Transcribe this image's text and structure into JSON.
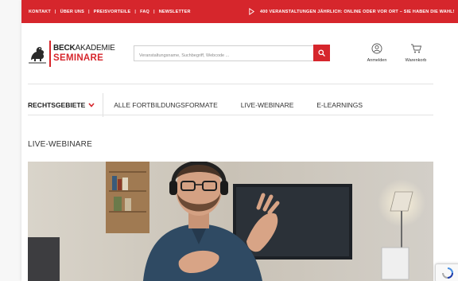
{
  "topbar": {
    "nav": [
      "KONTAKT",
      "ÜBER UNS",
      "PREISVORTEILE",
      "FAQ",
      "NEWSLETTER"
    ],
    "promo": "400 VERANSTALTUNGEN JÄHRLICH: ONLINE ODER VOR ORT – SIE HABEN DIE WAHL!"
  },
  "logo": {
    "line1_bold": "BECK",
    "line1_light": "AKADEMIE",
    "line2": "SEMINARE"
  },
  "search": {
    "placeholder": "Veranstaltungsname, Suchbegriff, Webcode ..."
  },
  "header": {
    "login_label": "Anmelden",
    "cart_label": "Warenkorb"
  },
  "mainnav": {
    "rechtsgebiete": "RECHTSGEBIETE",
    "items": [
      "ALLE FORTBILDUNGSFORMATE",
      "LIVE-WEBINARE",
      "E-LEARNINGS"
    ]
  },
  "page": {
    "title": "LIVE-WEBINARE"
  },
  "colors": {
    "brand_red": "#d6262c",
    "text_dark": "#222222",
    "divider": "#e3e3e3"
  },
  "icons": {
    "search": "search-icon",
    "user": "user-icon",
    "cart": "cart-icon",
    "chevron": "chevron-down-icon",
    "play": "play-icon",
    "recaptcha": "recaptcha-icon"
  }
}
